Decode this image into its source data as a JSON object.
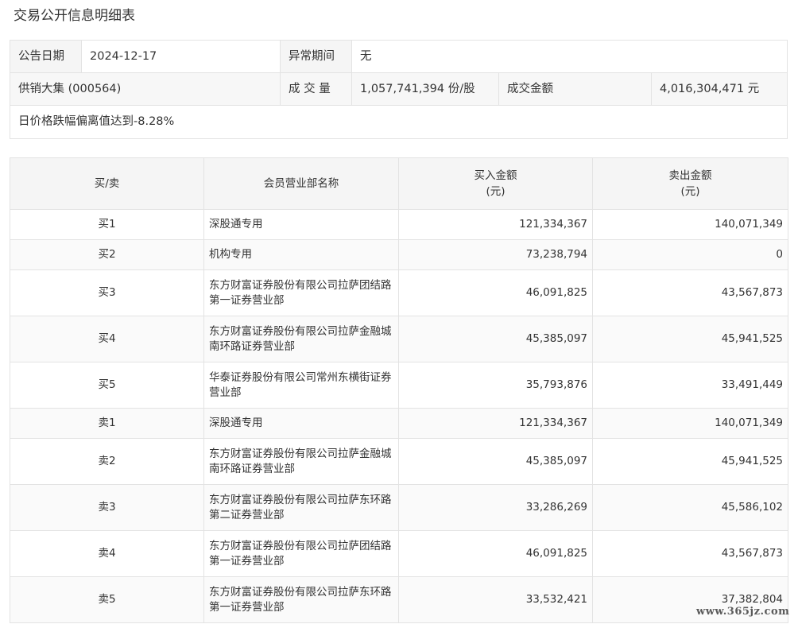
{
  "page_title": "交易公开信息明细表",
  "summary": {
    "announce_date_label": "公告日期",
    "announce_date_value": "2024-12-17",
    "abnormal_period_label": "异常期间",
    "abnormal_period_value": "无",
    "stock": "供销大集 (000564)",
    "volume_label": "成 交 量",
    "volume_value": "1,057,741,394 份/股",
    "amount_label": "成交金额",
    "amount_value": "4,016,304,471 元",
    "reason": "日价格跌幅偏离值达到-8.28%"
  },
  "table": {
    "headers": {
      "side": "买/卖",
      "broker": "会员营业部名称",
      "buy_line1": "买入金额",
      "buy_line2": "(元)",
      "sell_line1": "卖出金额",
      "sell_line2": "(元)"
    },
    "rows": [
      {
        "side": "买1",
        "broker": "深股通专用",
        "buy": "121,334,367",
        "sell": "140,071,349"
      },
      {
        "side": "买2",
        "broker": "机构专用",
        "buy": "73,238,794",
        "sell": "0"
      },
      {
        "side": "买3",
        "broker": "东方财富证券股份有限公司拉萨团结路第一证券营业部",
        "buy": "46,091,825",
        "sell": "43,567,873"
      },
      {
        "side": "买4",
        "broker": "东方财富证券股份有限公司拉萨金融城南环路证券营业部",
        "buy": "45,385,097",
        "sell": "45,941,525"
      },
      {
        "side": "买5",
        "broker": "华泰证券股份有限公司常州东横街证券营业部",
        "buy": "35,793,876",
        "sell": "33,491,449"
      },
      {
        "side": "卖1",
        "broker": "深股通专用",
        "buy": "121,334,367",
        "sell": "140,071,349"
      },
      {
        "side": "卖2",
        "broker": "东方财富证券股份有限公司拉萨金融城南环路证券营业部",
        "buy": "45,385,097",
        "sell": "45,941,525"
      },
      {
        "side": "卖3",
        "broker": "东方财富证券股份有限公司拉萨东环路第二证券营业部",
        "buy": "33,286,269",
        "sell": "45,586,102"
      },
      {
        "side": "卖4",
        "broker": "东方财富证券股份有限公司拉萨团结路第一证券营业部",
        "buy": "46,091,825",
        "sell": "43,567,873"
      },
      {
        "side": "卖5",
        "broker": "东方财富证券股份有限公司拉萨东环路第一证券营业部",
        "buy": "33,532,421",
        "sell": "37,382,804"
      }
    ]
  },
  "watermark": "www.365jz.com"
}
